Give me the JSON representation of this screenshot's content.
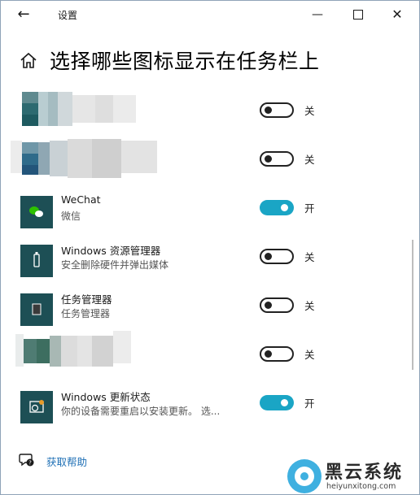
{
  "window": {
    "title": "设置",
    "back_icon": "back-arrow-icon",
    "controls": {
      "minimize": "minimize-icon",
      "maximize": "maximize-icon",
      "close": "close-icon"
    }
  },
  "header": {
    "title": "选择哪些图标显示在任务栏上",
    "icon": "home-icon"
  },
  "items": [
    {
      "name": "",
      "desc": "",
      "state": "关",
      "on": false,
      "icon": "blurred-app-icon"
    },
    {
      "name": "",
      "desc": "",
      "state": "关",
      "on": false,
      "icon": "blurred-app-icon"
    },
    {
      "name": "WeChat",
      "desc": "微信",
      "state": "开",
      "on": true,
      "icon": "wechat-icon"
    },
    {
      "name": "Windows 资源管理器",
      "desc": "安全删除硬件并弹出媒体",
      "state": "关",
      "on": false,
      "icon": "usb-icon"
    },
    {
      "name": "任务管理器",
      "desc": "任务管理器",
      "state": "关",
      "on": false,
      "icon": "task-manager-icon"
    },
    {
      "name": "",
      "desc": "",
      "state": "关",
      "on": false,
      "icon": "blurred-app-icon"
    },
    {
      "name": "Windows 更新状态",
      "desc": "你的设备需要重启以安装更新。 选...",
      "state": "开",
      "on": true,
      "icon": "windows-update-icon"
    }
  ],
  "footer": {
    "help_label": "获取帮助",
    "help_icon": "help-chat-icon"
  },
  "watermark": {
    "text": "黑云系统",
    "url": "heiyunxitong.com"
  },
  "colors": {
    "toggle_on": "#1aa5c5",
    "app_tile": "#1d4f55",
    "link": "#1e6fb5"
  }
}
